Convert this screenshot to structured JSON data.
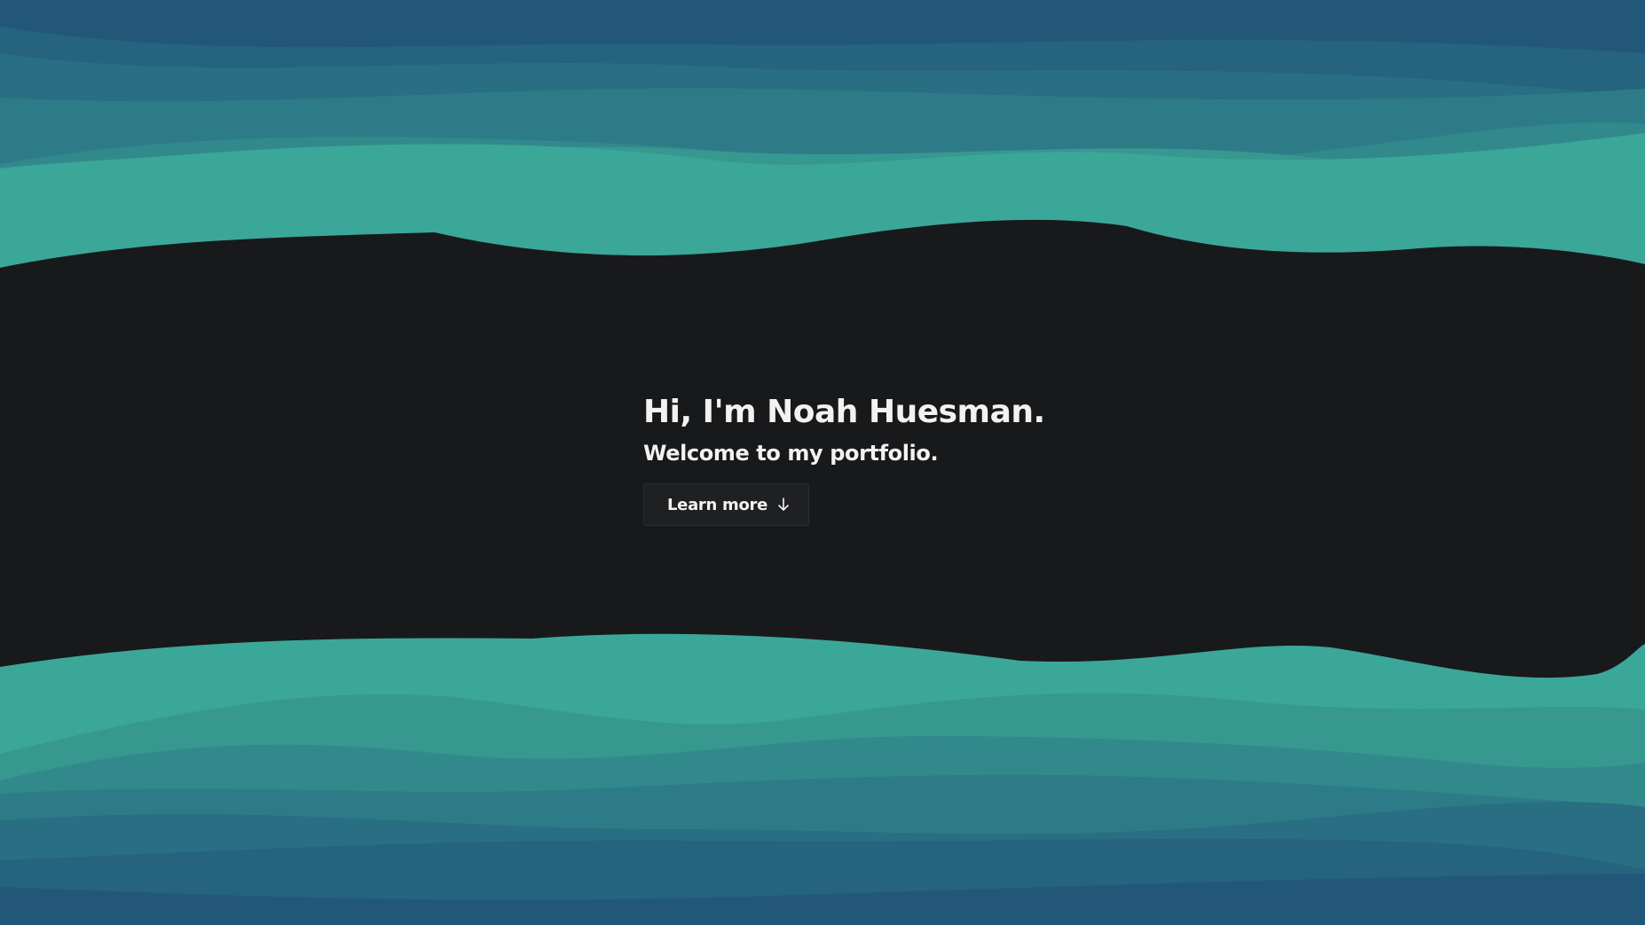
{
  "hero": {
    "title": "Hi, I'm Noah Huesman.",
    "subtitle": "Welcome to my portfolio.",
    "button_label": "Learn more"
  },
  "colors": {
    "background": "#18191b",
    "wave_layers": [
      "#225779",
      "#25637f",
      "#296e83",
      "#2e7b88",
      "#32898c",
      "#37988f",
      "#3aa799"
    ],
    "text": "#f2f2f2"
  },
  "icons": {
    "button_icon": "arrow-down-icon"
  }
}
